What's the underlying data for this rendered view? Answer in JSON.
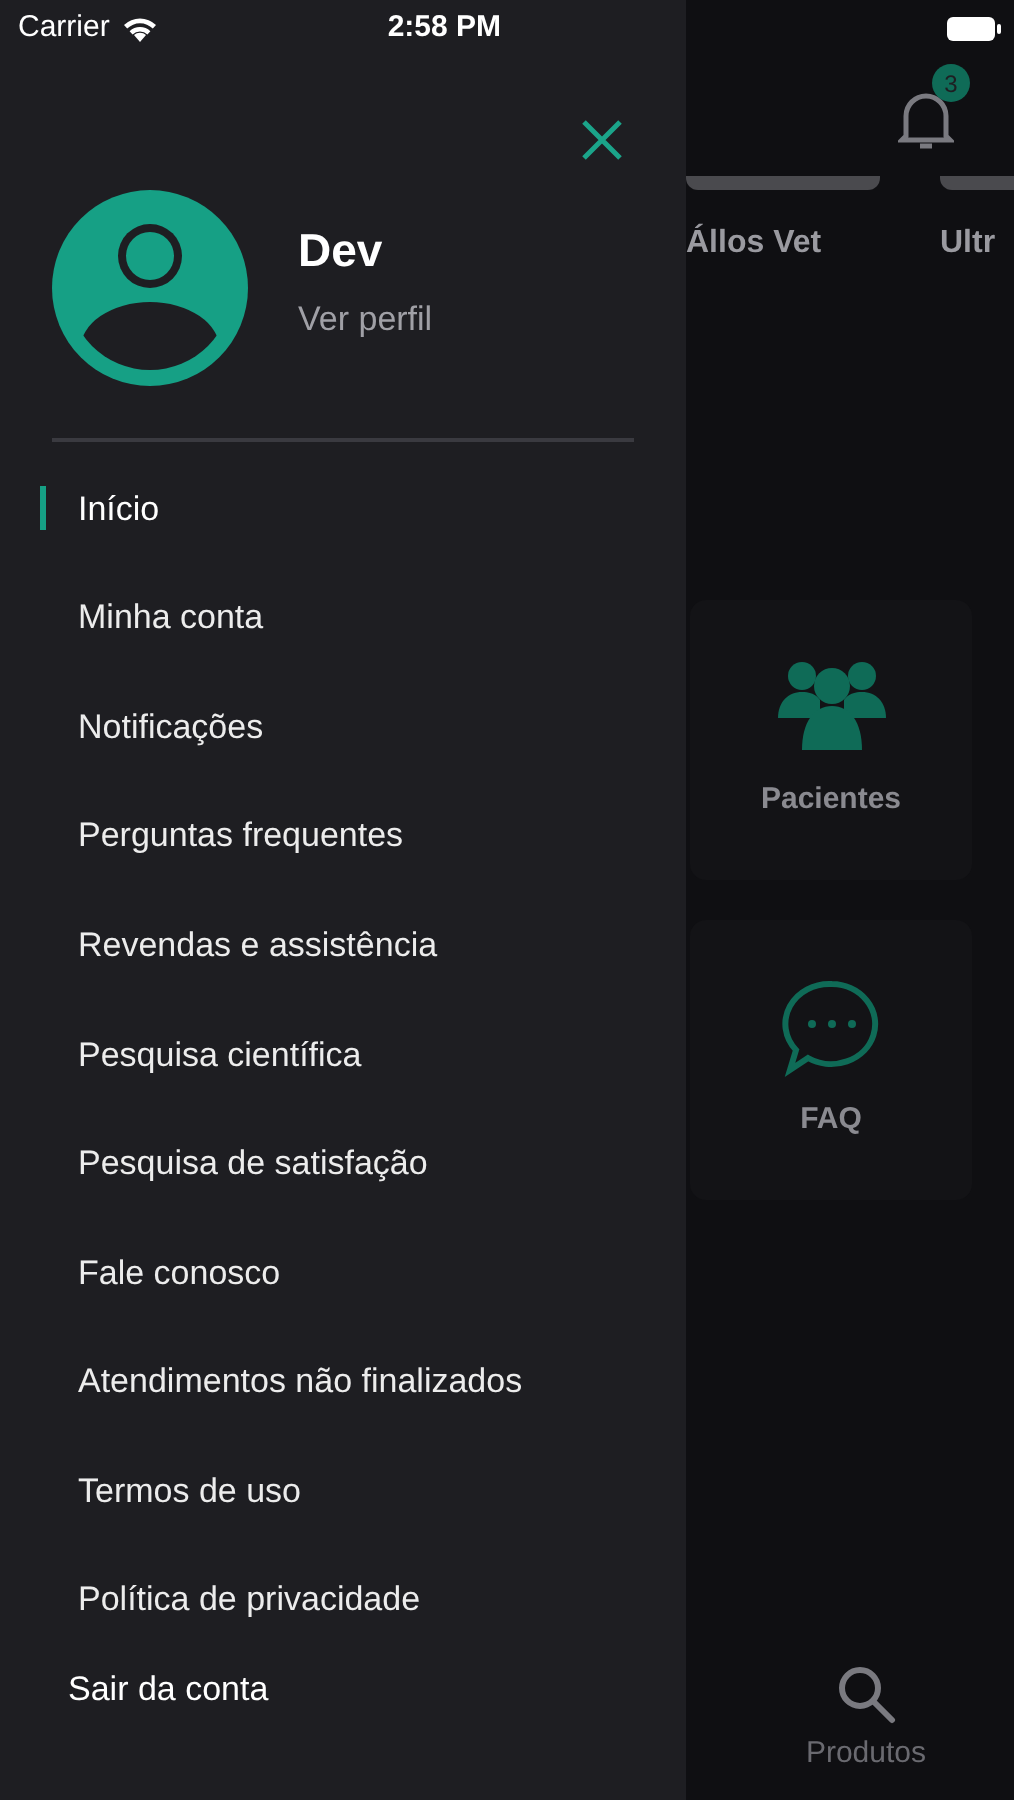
{
  "status_bar": {
    "carrier": "Carrier",
    "time": "2:58 PM"
  },
  "drawer": {
    "profile": {
      "name": "Dev",
      "link": "Ver perfil"
    },
    "menu": [
      {
        "label": "Início",
        "selected": true
      },
      {
        "label": "Minha conta",
        "selected": false
      },
      {
        "label": "Notificações",
        "selected": false
      },
      {
        "label": "Perguntas frequentes",
        "selected": false
      },
      {
        "label": "Revendas e assistência",
        "selected": false
      },
      {
        "label": "Pesquisa científica",
        "selected": false
      },
      {
        "label": "Pesquisa de satisfação",
        "selected": false
      },
      {
        "label": "Fale conosco",
        "selected": false
      },
      {
        "label": "Atendimentos não finalizados",
        "selected": false
      },
      {
        "label": "Termos de uso",
        "selected": false
      },
      {
        "label": "Política de privacidade",
        "selected": false
      }
    ],
    "logout": "Sair da conta"
  },
  "background": {
    "notification_count": "3",
    "carousel": [
      "Állos Vet",
      "Ultr"
    ],
    "tiles": [
      {
        "label": "Pacientes",
        "kind": "people"
      },
      {
        "label": "FAQ",
        "kind": "chat"
      }
    ],
    "tab_bar": [
      {
        "label": "Produtos",
        "kind": "search"
      }
    ]
  }
}
